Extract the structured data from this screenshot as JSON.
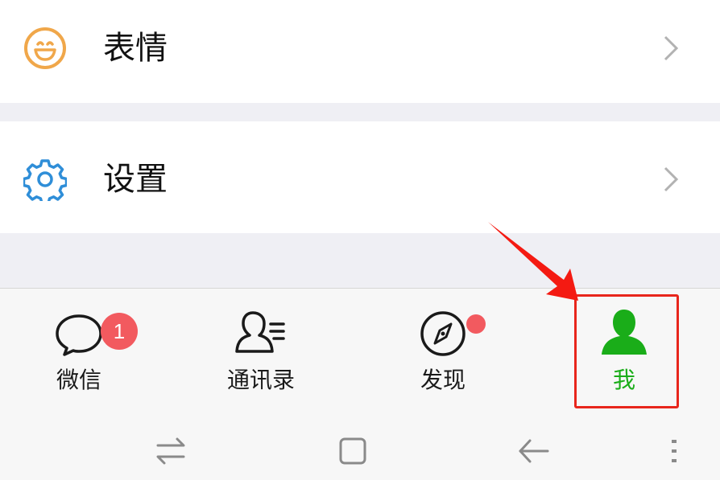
{
  "menu": {
    "emoji_label": "表情",
    "settings_label": "设置"
  },
  "tabs": [
    {
      "label": "微信",
      "icon": "chat-bubble-icon",
      "badge": "1"
    },
    {
      "label": "通讯录",
      "icon": "contacts-icon"
    },
    {
      "label": "发现",
      "icon": "compass-icon",
      "dot": true
    },
    {
      "label": "我",
      "icon": "person-icon",
      "active": true
    }
  ],
  "system_nav": [
    "swap-icon",
    "home-square-icon",
    "back-arrow-icon",
    "menu-dots-icon"
  ],
  "colors": {
    "active_green": "#1aad19",
    "badge_red": "#f25a5f",
    "highlight_red": "#e8261c",
    "emoji_orange": "#f0a74a",
    "settings_blue": "#2f8ed8"
  }
}
